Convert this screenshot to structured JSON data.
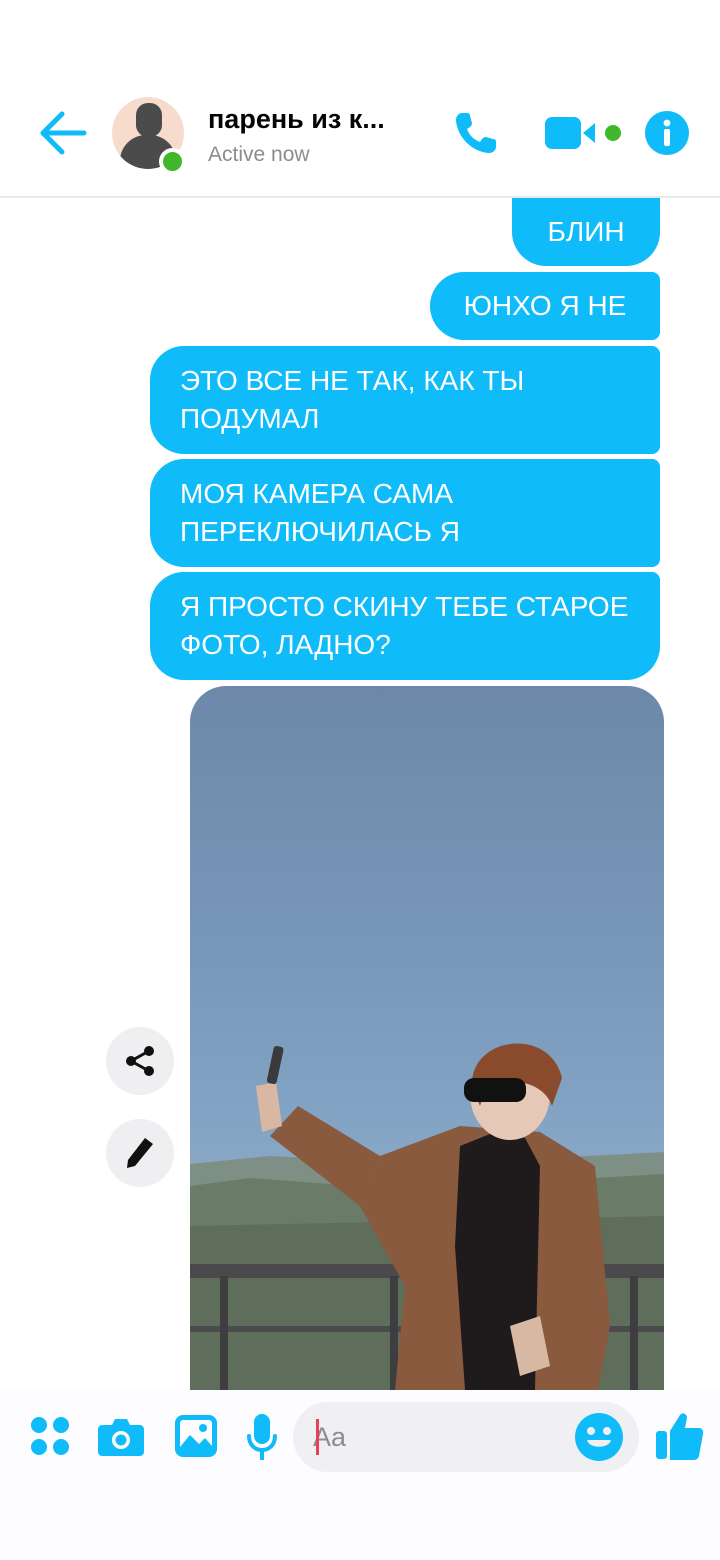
{
  "header": {
    "back_icon": "arrow-left-icon",
    "contact_name": "парень из к...",
    "status": "Active now",
    "online": true,
    "accent_color": "#0fbcf9"
  },
  "messages": [
    {
      "text": "БЛИН",
      "sender": "me"
    },
    {
      "text": "ЮНХО Я НЕ",
      "sender": "me"
    },
    {
      "text": "ЭТО ВСЕ НЕ ТАК, КАК ТЫ ПОДУМАЛ",
      "sender": "me"
    },
    {
      "text": "МОЯ КАМЕРА САМА ПЕРЕКЛЮЧИЛАСЬ Я",
      "sender": "me"
    },
    {
      "text": "Я ПРОСТО СКИНУ ТЕБЕ СТАРОЕ ФОТО, ЛАДНО?",
      "sender": "me"
    }
  ],
  "photo_actions": [
    "share-icon",
    "pencil-icon"
  ],
  "composer": {
    "placeholder": "Aa",
    "value": "",
    "icons": [
      "apps-icon",
      "camera-icon",
      "image-icon",
      "microphone-icon",
      "emoji-icon",
      "thumbs-up-icon"
    ]
  }
}
